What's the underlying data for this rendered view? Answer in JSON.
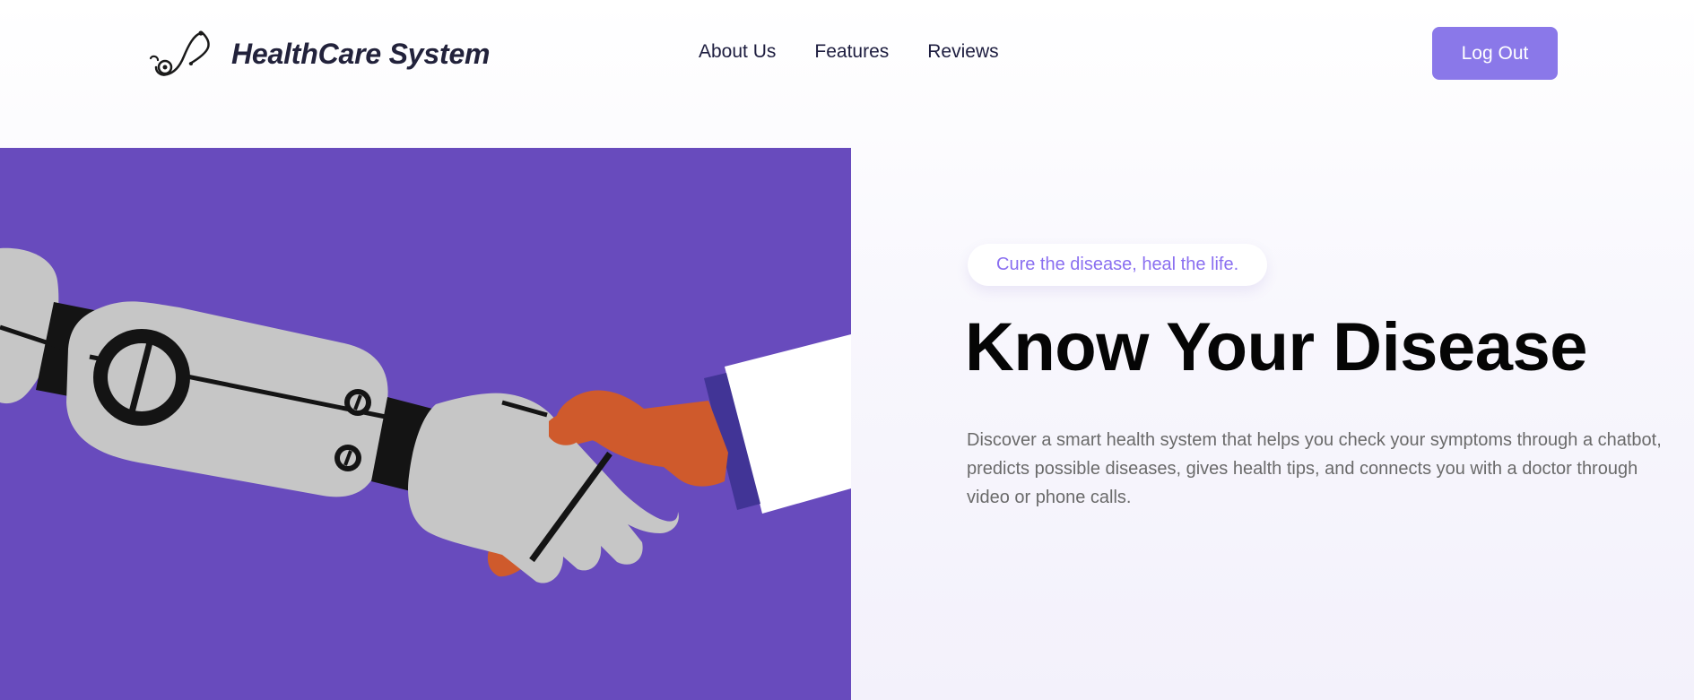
{
  "header": {
    "brand_name": "HealthCare System",
    "brand_icon": "stethoscope-icon",
    "nav": [
      {
        "label": "About Us"
      },
      {
        "label": "Features"
      },
      {
        "label": "Reviews"
      }
    ],
    "logout_label": "Log Out"
  },
  "hero": {
    "image_subject": "robot-human-handshake-illustration",
    "tagline": "Cure the disease, heal the life.",
    "title": "Know Your Disease",
    "description": "Discover a smart health system that helps you check your symptoms through a chatbot, predicts possible diseases, gives health tips, and connects you with a doctor through video or phone calls."
  },
  "colors": {
    "accent": "#8a78e9",
    "tagline_text": "#8a6ff0",
    "hero_image_bg": "#684bbd",
    "robot_gray": "#c6c6c6",
    "hand_orange": "#cf5a2c",
    "sleeve_white": "#ffffff",
    "cuff_indigo": "#413496"
  }
}
